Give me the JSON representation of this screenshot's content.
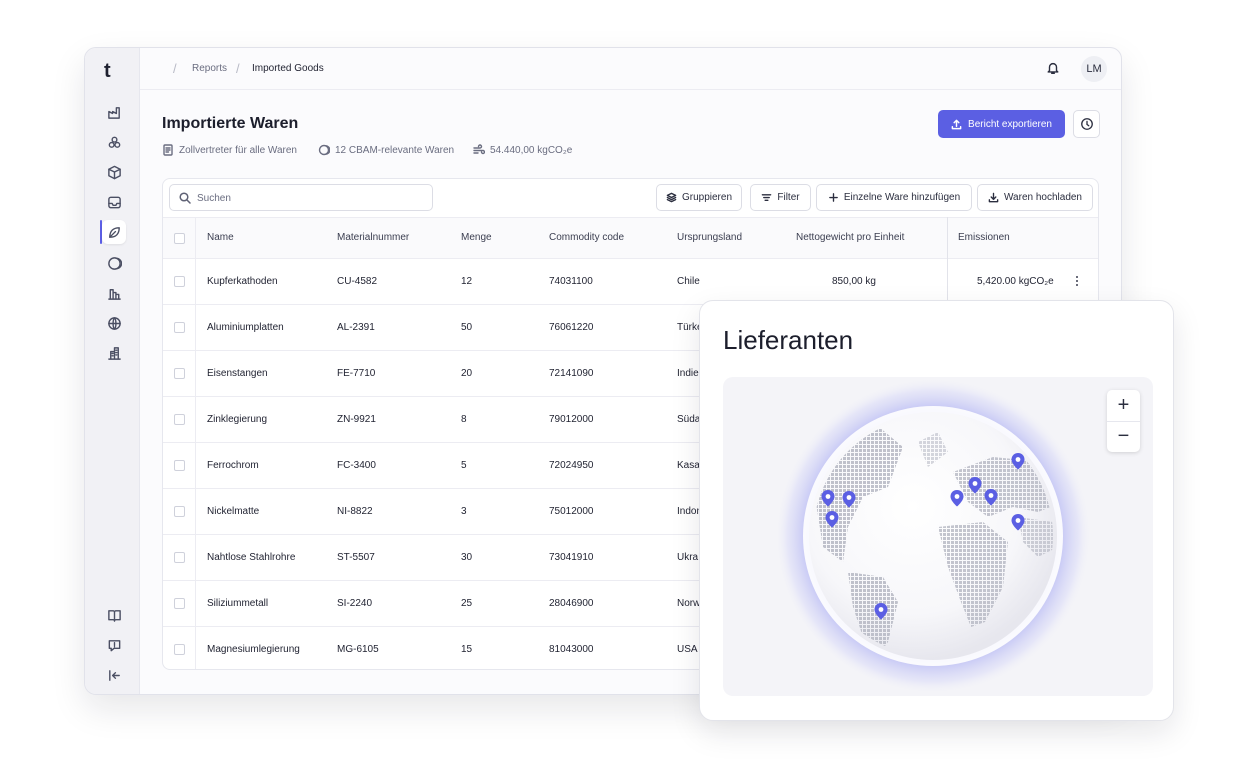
{
  "sidebar": {
    "logo": "t",
    "items": [
      "factory-icon",
      "cubes-icon",
      "box-icon",
      "inbox-icon",
      "leaf-icon",
      "moon-icon",
      "chart-icon",
      "globe-icon",
      "building-icon"
    ],
    "footer_items": [
      "book-icon",
      "feedback-icon",
      "collapse-icon"
    ]
  },
  "breadcrumb": {
    "items": [
      "Reports",
      "Imported Goods"
    ]
  },
  "header": {
    "avatar_initials": "LM"
  },
  "page": {
    "title": "Importierte Waren",
    "meta_customs": "Zollvertreter für alle Waren",
    "meta_cbam": "12 CBAM-relevante Waren",
    "meta_emissions": "54.440,00 kgCO₂e",
    "export_label": "Bericht exportieren"
  },
  "toolbar": {
    "search_placeholder": "Suchen",
    "group_label": "Gruppieren",
    "filter_label": "Filter",
    "add_label": "Einzelne Ware hinzufügen",
    "upload_label": "Waren hochladen"
  },
  "table": {
    "columns": [
      "Name",
      "Materialnummer",
      "Menge",
      "Commodity code",
      "Ursprungsland",
      "Nettogewicht pro Einheit",
      "Emissionen"
    ],
    "rows": [
      {
        "name": "Kupferkathoden",
        "material": "CU-4582",
        "qty": "12",
        "code": "74031100",
        "origin": "Chile",
        "weight": "850,00 kg",
        "emissions": "5,420.00 kgCO₂e"
      },
      {
        "name": "Aluminiumplatten",
        "material": "AL-2391",
        "qty": "50",
        "code": "76061220",
        "origin": "Türke"
      },
      {
        "name": "Eisenstangen",
        "material": "FE-7710",
        "qty": "20",
        "code": "72141090",
        "origin": "Indie"
      },
      {
        "name": "Zinklegierung",
        "material": "ZN-9921",
        "qty": "8",
        "code": "79012000",
        "origin": "Süda"
      },
      {
        "name": "Ferrochrom",
        "material": "FC-3400",
        "qty": "5",
        "code": "72024950",
        "origin": "Kasa"
      },
      {
        "name": "Nickelmatte",
        "material": "NI-8822",
        "qty": "3",
        "code": "75012000",
        "origin": "Indon"
      },
      {
        "name": "Nahtlose Stahlrohre",
        "material": "ST-5507",
        "qty": "30",
        "code": "73041910",
        "origin": "Ukra"
      },
      {
        "name": "Siliziummetall",
        "material": "SI-2240",
        "qty": "25",
        "code": "28046900",
        "origin": "Norw"
      },
      {
        "name": "Magnesiumlegierung",
        "material": "MG-6105",
        "qty": "15",
        "code": "81043000",
        "origin": "USA"
      }
    ]
  },
  "suppliers_map": {
    "title": "Lieferanten",
    "zoom_in": "+",
    "zoom_out": "−",
    "pin_color": "#5b5fe3",
    "glow_color": "#8b8ff0"
  },
  "colors": {
    "accent": "#5b5fe3"
  }
}
